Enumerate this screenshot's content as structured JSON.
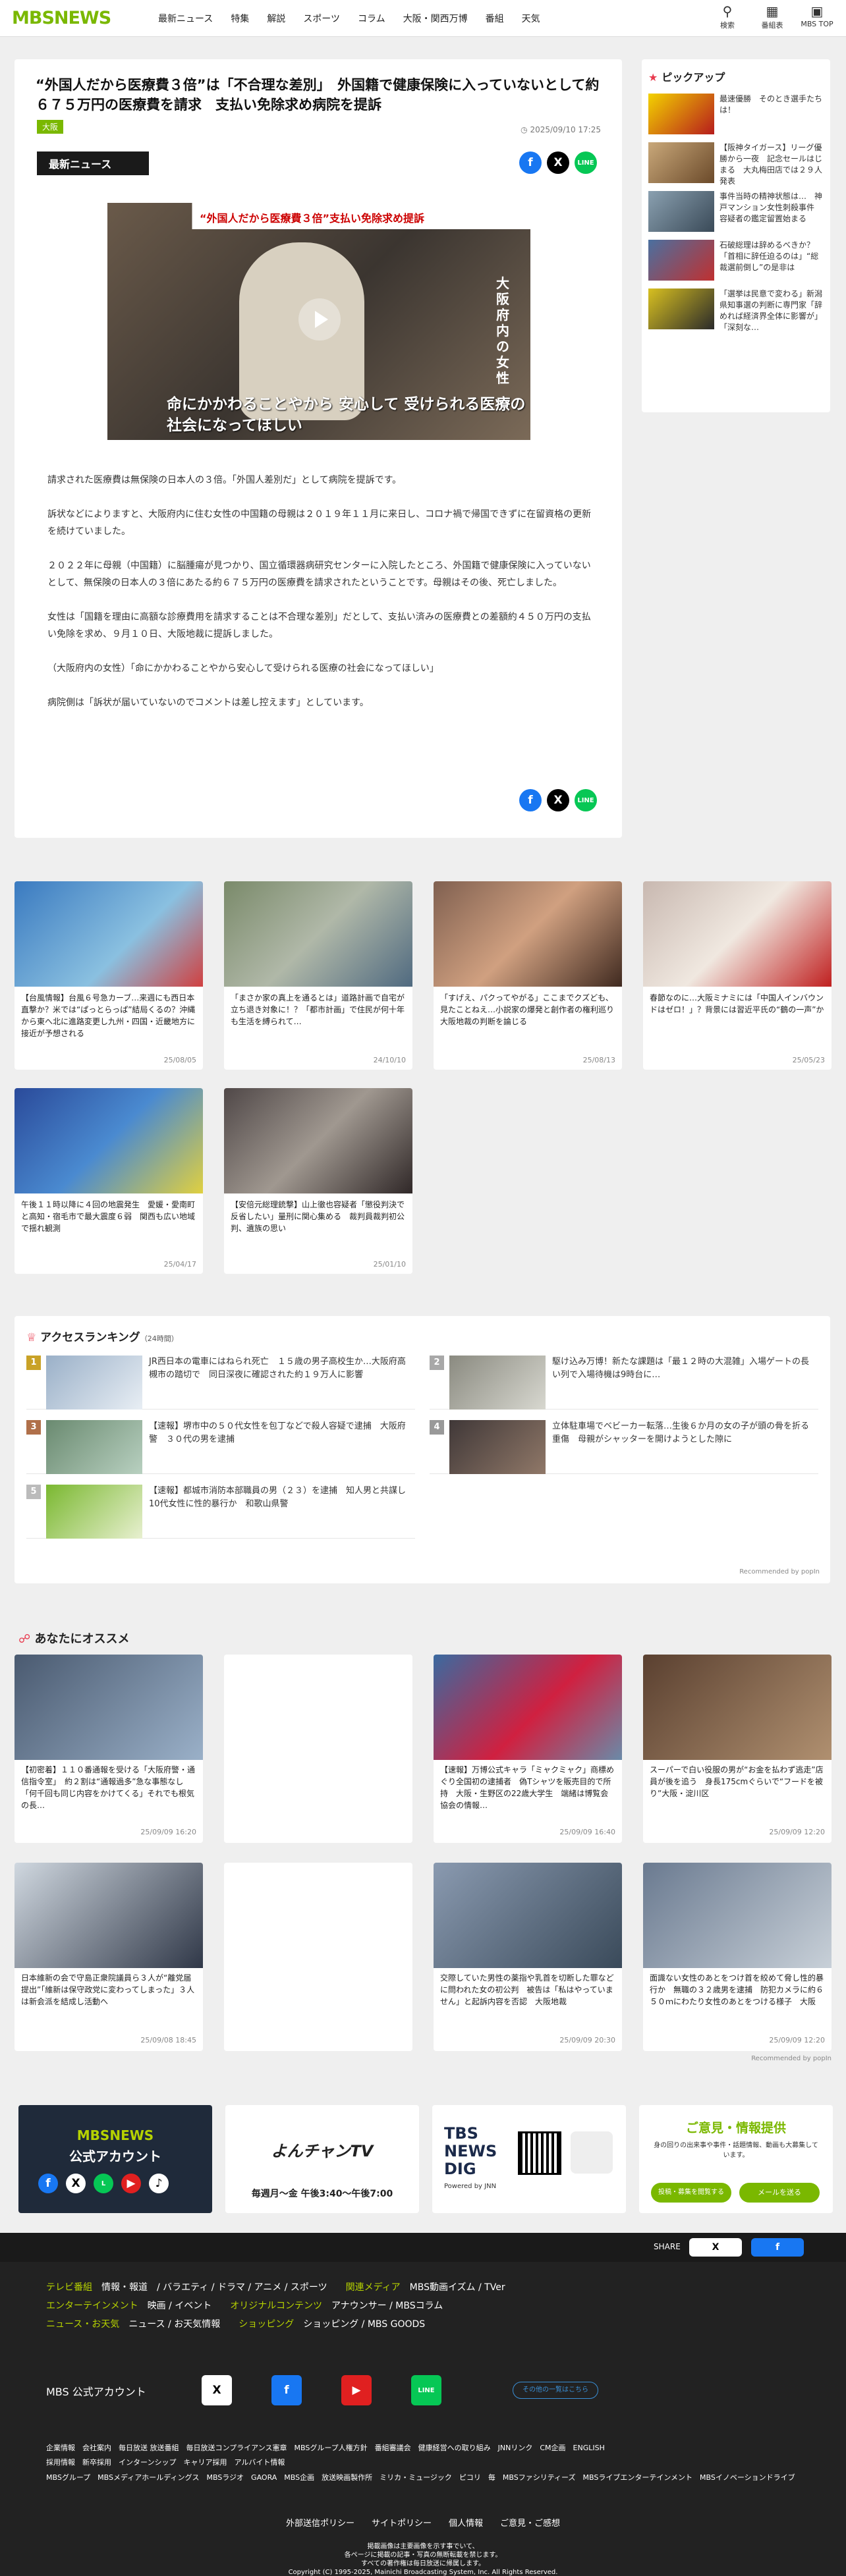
{
  "header": {
    "logo": "MBSNEWS",
    "nav": [
      "最新ニュース",
      "特集",
      "解説",
      "スポーツ",
      "コラム",
      "大阪・関西万博",
      "番組",
      "天気"
    ],
    "icons": [
      {
        "name": "search-icon",
        "label": "検索"
      },
      {
        "name": "calendar-icon",
        "label": "番組表"
      },
      {
        "name": "tv-icon",
        "label": "MBS TOP"
      }
    ]
  },
  "article": {
    "title": "“外国人だから医療費３倍”は「不合理な差別」　外国籍で健康保険に入っていないとして約６７５万円の医療費を請求　支払い免除求め病院を提訴",
    "category": "大阪",
    "date": "2025/09/10 17:25",
    "badge": "最新ニュース",
    "video": {
      "caption_top": "“外国人だから医療費３倍”支払い免除求め提訴",
      "caption_side": "大阪府内の女性",
      "subtitle": "命にかかわることやから 安心して 受けられる医療の社会になってほしい"
    },
    "paragraphs": [
      "請求された医療費は無保険の日本人の３倍。「外国人差別だ」として病院を提訴です。",
      "訴状などによりますと、大阪府内に住む女性の中国籍の母親は２０１９年１１月に来日し、コロナ禍で帰国できずに在留資格の更新を続けていました。",
      "２０２２年に母親（中国籍）に脳腫瘍が見つかり、国立循環器病研究センターに入院したところ、外国籍で健康保険に入っていないとして、無保険の日本人の３倍にあたる約６７５万円の医療費を請求されたということです。母親はその後、死亡しました。",
      "女性は「国籍を理由に高額な診療費用を請求することは不合理な差別」だとして、支払い済みの医療費との差額約４５０万円の支払い免除を求め、９月１０日、大阪地裁に提訴しました。",
      "（大阪府内の女性）「命にかかわることやから安心して受けられる医療の社会になってほしい」",
      "病院側は「訴状が届いていないのでコメントは差し控えます」としています。"
    ]
  },
  "share": {
    "fb": "f",
    "x": "X",
    "line": "LINE"
  },
  "pickup": {
    "title": "ピックアップ",
    "items": [
      "最速優勝　そのとき選手たちは！",
      "【阪神タイガース】リーグ優勝から一夜　記念セールはじまる　大丸梅田店では２９人発表",
      "事件当時の精神状態は…　神戸マンション女性刺殺事件　容疑者の鑑定留置始まる",
      "石破総理は辞めるべきか？「首相に辞任迫るのは」“総裁選前倒し”の是非は",
      "「選挙は民意で変わる」新潟県知事選の判断に専門家「辞めれば経済界全体に影響が」「深刻な…"
    ]
  },
  "grid": [
    {
      "text": "【台風情報】台風６号急カーブ…来週にも西日本直撃か？米では“ぱっとらっぱ”結局くるの？沖縄から東へ北に進路変更し九州・四国・近畿地方に接近が予想される",
      "date": "25/08/05"
    },
    {
      "text": "「まさか家の真上を通るとは」道路計画で自宅が立ち退き対象に！？「都市計画」で住民が何十年も生活を縛られて…",
      "date": "24/10/10"
    },
    {
      "text": "「すげえ、パクってやがる」ここまでクズども、見たことねえ…小説家の爆発と創作者の権利巡り大阪地裁の判断を論じる",
      "date": "25/08/13"
    },
    {
      "text": "春節なのに…大阪ミナミには「中国人インバウンドはゼロ！」？背景には習近平氏の“鶴の一声”か",
      "date": "25/05/23"
    },
    {
      "text": "午後１１時以降に４回の地震発生　愛媛・愛南町と高知・宿毛市で最大震度６弱　関西も広い地域で揺れ観測",
      "date": "25/04/17"
    },
    {
      "text": "【安倍元総理銃撃】山上徹也容疑者「懲役判決で反省したい」量刑に関心集める　裁判員裁判初公判、遺族の思い",
      "date": "25/01/10"
    }
  ],
  "ranking": {
    "title": "アクセスランキング",
    "sub": "（24時間）",
    "items": [
      "JR西日本の電車にはねられ死亡　１５歳の男子高校生か…大阪府高槻市の踏切で　同日深夜に確認された約１９万人に影響",
      "駆け込み万博！新たな課題は「最１２時の大混雑」入場ゲートの長い列で入場待機は9時台に…",
      "【速報】堺市中の５０代女性を包丁などで殺人容疑で逮捕　大阪府警　３０代の男を逮捕",
      "立体駐車場でベビーカー転落…生後６か月の女の子が頭の骨を折る重傷　母親がシャッターを開けようとした隙に",
      "【速報】都城市消防本部職員の男（２３）を逮捕　知人男と共謀し10代女性に性的暴行か　和歌山県警"
    ],
    "powered": "Recommended by popIn"
  },
  "recommend": {
    "title": "あなたにオススメ",
    "items": [
      {
        "text": "【初密着】１１０番通報を受ける「大阪府警・通信指令室」　約２割は“通報過多”急な事態なし「何千回も同じ内容をかけてくる」それでも根気の長…",
        "date": "25/09/09 16:20"
      },
      {
        "text": "",
        "date": ""
      },
      {
        "text": "【速報】万博公式キャラ「ミャクミャク」商標めぐり全国初の逮捕者　偽Tシャツを販売目的で所持　大阪・生野区の22歳大学生　端緒は博覧会協会の情報…",
        "date": "25/09/09 16:40"
      },
      {
        "text": "スーパーで白い役服の男が“お金を払わず逃走”店員が後を追う　身長175cmぐらいで“フードを被り”大阪・淀川区",
        "date": "25/09/09 12:20"
      },
      {
        "text": "日本維新の会で守島正衆院議員ら３人が“離党届提出”「維新は保守政党に変わってしまった」３人は新会派を結成し活動へ",
        "date": "25/09/08 18:45"
      },
      {
        "text": "",
        "date": ""
      },
      {
        "text": "交際していた男性の薬指や乳首を切断した罪などに問われた女の初公判　被告は「私はやっていません」と起訴内容を否認　大阪地裁",
        "date": "25/09/09 20:30"
      },
      {
        "text": "面識ない女性のあとをつけ首を絞めて脅し性的暴行か　無職の３２歳男を逮捕　防犯カメラに約６５０ｍにわたり女性のあとをつける様子　大阪",
        "date": "25/09/09 12:20"
      }
    ],
    "powered": "Recommended by popIn"
  },
  "banners": {
    "b1a": "MBSNEWS",
    "b1b": "公式アカウント",
    "b2": "よんチャンTV",
    "b2sub": "毎週月〜金 午後3:40〜午後7:00",
    "b3a": "TBS",
    "b3b": "NEWS",
    "b3c": "DIG",
    "b3d": "Powered by JNN",
    "b4": "ご意見・情報提供",
    "b4sub": "身の回りの出来事や事件・話題情報、動画も大募集しています。",
    "b4btn1": "投稿・募集を閲覧する",
    "b4btn2": "メールを送る"
  },
  "footer": {
    "share": "SHARE",
    "row1": {
      "label": "テレビ番組",
      "items": "情報・報道　/ バラエティ / ドラマ / アニメ / スポーツ",
      "label2": "関連メディア",
      "items2": "MBS動画イズム / TVer"
    },
    "row2": {
      "label": "エンターテインメント",
      "items": "映画 / イベント",
      "label2": "オリジナルコンテンツ",
      "items2": "アナウンサー / MBSコラム"
    },
    "row3": {
      "label": "ニュース・お天気",
      "items": "ニュース / お天気情報",
      "label2": "ショッピング",
      "items2": "ショッピング / MBS GOODS"
    },
    "official": "MBS 公式アカウント",
    "others": "その他の一覧はこちら",
    "links1": "企業情報　会社案内　毎日放送 放送番組　毎日放送コンプライアンス憲章　MBSグループ人権方針　番組審議会　健康経営への取り組み　JNNリンク　CM企画　ENGLISH",
    "links2": "採用情報　新卒採用　インターンシップ　キャリア採用　アルバイト情報",
    "links3": "MBSグループ　MBSメディアホールディングス　MBSラジオ　GAORA　MBS企画　放送映画製作所　ミリカ・ミュージック　ピコリ　毎　MBSファシリティーズ　MBSライブエンターテインメント　MBSイノベーションドライブ",
    "links4": "外部送信ポリシー　　サイトポリシー　　個人情報　　ご意見・ご感想",
    "copy1": "掲載画像は主要画像を示す事でいて、",
    "copy2": "各ページに掲載の記事・写真の無断転載を禁じます。",
    "copy3": "すべての著作権は毎日放送に帰属します。",
    "copy4": "Copyright (C) 1995-2025, Mainichi Broadcasting System, Inc. All Rights Reserved."
  }
}
